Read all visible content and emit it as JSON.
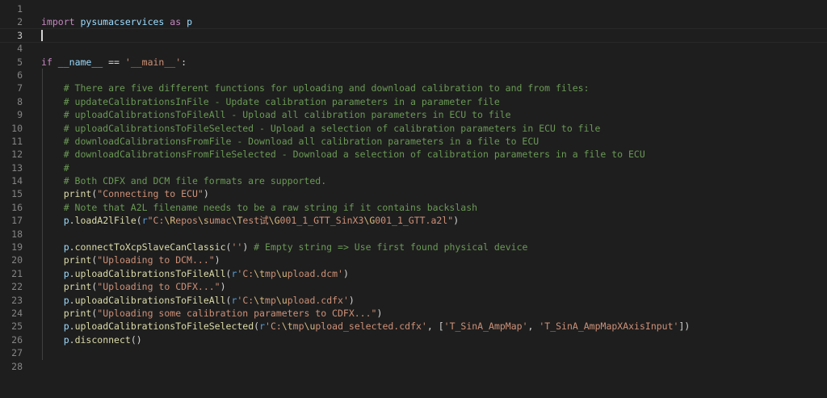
{
  "editor": {
    "lines": [
      {
        "n": "1",
        "tokens": []
      },
      {
        "n": "2",
        "tokens": [
          [
            "kw",
            "import"
          ],
          [
            "op",
            " "
          ],
          [
            "var",
            "pysumacservices"
          ],
          [
            "op",
            " "
          ],
          [
            "kw",
            "as"
          ],
          [
            "op",
            " "
          ],
          [
            "var",
            "p"
          ]
        ]
      },
      {
        "n": "3",
        "tokens": [],
        "current": true
      },
      {
        "n": "4",
        "tokens": []
      },
      {
        "n": "5",
        "tokens": [
          [
            "kw",
            "if"
          ],
          [
            "op",
            " "
          ],
          [
            "var",
            "__name__"
          ],
          [
            "op",
            " == "
          ],
          [
            "str",
            "'__main__'"
          ],
          [
            "op",
            ":"
          ]
        ]
      },
      {
        "n": "6",
        "tokens": []
      },
      {
        "n": "7",
        "tokens": [
          [
            "op",
            "    "
          ],
          [
            "cm",
            "# There are five different functions for uploading and download calibration to and from files:"
          ]
        ]
      },
      {
        "n": "8",
        "tokens": [
          [
            "op",
            "    "
          ],
          [
            "cm",
            "# updateCalibrationsInFile - Update calibration parameters in a parameter file"
          ]
        ]
      },
      {
        "n": "9",
        "tokens": [
          [
            "op",
            "    "
          ],
          [
            "cm",
            "# uploadCalibrationsToFileAll - Upload all calibration parameters in ECU to file"
          ]
        ]
      },
      {
        "n": "10",
        "tokens": [
          [
            "op",
            "    "
          ],
          [
            "cm",
            "# uploadCalibrationsToFileSelected - Upload a selection of calibration parameters in ECU to file"
          ]
        ]
      },
      {
        "n": "11",
        "tokens": [
          [
            "op",
            "    "
          ],
          [
            "cm",
            "# downloadCalibrationsFromFile - Download all calibration parameters in a file to ECU"
          ]
        ]
      },
      {
        "n": "12",
        "tokens": [
          [
            "op",
            "    "
          ],
          [
            "cm",
            "# downloadCalibrationsFromFileSelected - Download a selection of calibration parameters in a file to ECU"
          ]
        ]
      },
      {
        "n": "13",
        "tokens": [
          [
            "op",
            "    "
          ],
          [
            "cm",
            "#"
          ]
        ]
      },
      {
        "n": "14",
        "tokens": [
          [
            "op",
            "    "
          ],
          [
            "cm",
            "# Both CDFX and DCM file formats are supported."
          ]
        ]
      },
      {
        "n": "15",
        "tokens": [
          [
            "op",
            "    "
          ],
          [
            "fn",
            "print"
          ],
          [
            "op",
            "("
          ],
          [
            "str",
            "\"Connecting to ECU\""
          ],
          [
            "op",
            ")"
          ]
        ]
      },
      {
        "n": "16",
        "tokens": [
          [
            "op",
            "    "
          ],
          [
            "cm",
            "# Note that A2L filename needs to be a raw string if it contains backslash"
          ]
        ]
      },
      {
        "n": "17",
        "tokens": [
          [
            "op",
            "    "
          ],
          [
            "var",
            "p"
          ],
          [
            "op",
            "."
          ],
          [
            "fn",
            "loadA2lFile"
          ],
          [
            "op",
            "("
          ],
          [
            "kw2",
            "r"
          ],
          [
            "str",
            "\"C:"
          ],
          [
            "esc",
            "\\R"
          ],
          [
            "str",
            "epos"
          ],
          [
            "esc",
            "\\s"
          ],
          [
            "str",
            "umac"
          ],
          [
            "esc",
            "\\T"
          ],
          [
            "str",
            "est试"
          ],
          [
            "esc",
            "\\G"
          ],
          [
            "str",
            "001_1_GTT_SinX3"
          ],
          [
            "esc",
            "\\G"
          ],
          [
            "str",
            "001_1_GTT.a2l\""
          ],
          [
            "op",
            ")"
          ]
        ]
      },
      {
        "n": "18",
        "tokens": []
      },
      {
        "n": "19",
        "tokens": [
          [
            "op",
            "    "
          ],
          [
            "var",
            "p"
          ],
          [
            "op",
            "."
          ],
          [
            "fn",
            "connectToXcpSlaveCanClassic"
          ],
          [
            "op",
            "("
          ],
          [
            "str",
            "''"
          ],
          [
            "op",
            ") "
          ],
          [
            "cm",
            "# Empty string => Use first found physical device"
          ]
        ]
      },
      {
        "n": "20",
        "tokens": [
          [
            "op",
            "    "
          ],
          [
            "fn",
            "print"
          ],
          [
            "op",
            "("
          ],
          [
            "str",
            "\"Uploading to DCM...\""
          ],
          [
            "op",
            ")"
          ]
        ]
      },
      {
        "n": "21",
        "tokens": [
          [
            "op",
            "    "
          ],
          [
            "var",
            "p"
          ],
          [
            "op",
            "."
          ],
          [
            "fn",
            "uploadCalibrationsToFileAll"
          ],
          [
            "op",
            "("
          ],
          [
            "kw2",
            "r"
          ],
          [
            "str",
            "'C:"
          ],
          [
            "esc",
            "\\t"
          ],
          [
            "str",
            "mp"
          ],
          [
            "esc",
            "\\u"
          ],
          [
            "str",
            "pload.dcm'"
          ],
          [
            "op",
            ")"
          ]
        ]
      },
      {
        "n": "22",
        "tokens": [
          [
            "op",
            "    "
          ],
          [
            "fn",
            "print"
          ],
          [
            "op",
            "("
          ],
          [
            "str",
            "\"Uploading to CDFX...\""
          ],
          [
            "op",
            ")"
          ]
        ]
      },
      {
        "n": "23",
        "tokens": [
          [
            "op",
            "    "
          ],
          [
            "var",
            "p"
          ],
          [
            "op",
            "."
          ],
          [
            "fn",
            "uploadCalibrationsToFileAll"
          ],
          [
            "op",
            "("
          ],
          [
            "kw2",
            "r"
          ],
          [
            "str",
            "'C:"
          ],
          [
            "esc",
            "\\t"
          ],
          [
            "str",
            "mp"
          ],
          [
            "esc",
            "\\u"
          ],
          [
            "str",
            "pload.cdfx'"
          ],
          [
            "op",
            ")"
          ]
        ]
      },
      {
        "n": "24",
        "tokens": [
          [
            "op",
            "    "
          ],
          [
            "fn",
            "print"
          ],
          [
            "op",
            "("
          ],
          [
            "str",
            "\"Uploading some calibration parameters to CDFX...\""
          ],
          [
            "op",
            ")"
          ]
        ]
      },
      {
        "n": "25",
        "tokens": [
          [
            "op",
            "    "
          ],
          [
            "var",
            "p"
          ],
          [
            "op",
            "."
          ],
          [
            "fn",
            "uploadCalibrationsToFileSelected"
          ],
          [
            "op",
            "("
          ],
          [
            "kw2",
            "r"
          ],
          [
            "str",
            "'C:"
          ],
          [
            "esc",
            "\\t"
          ],
          [
            "str",
            "mp"
          ],
          [
            "esc",
            "\\u"
          ],
          [
            "str",
            "pload_selected.cdfx'"
          ],
          [
            "op",
            ", ["
          ],
          [
            "str",
            "'T_SinA_AmpMap'"
          ],
          [
            "op",
            ", "
          ],
          [
            "str",
            "'T_SinA_AmpMapXAxisInput'"
          ],
          [
            "op",
            "])"
          ]
        ]
      },
      {
        "n": "26",
        "tokens": [
          [
            "op",
            "    "
          ],
          [
            "var",
            "p"
          ],
          [
            "op",
            "."
          ],
          [
            "fn",
            "disconnect"
          ],
          [
            "op",
            "()"
          ]
        ]
      },
      {
        "n": "27",
        "tokens": []
      },
      {
        "n": "28",
        "tokens": []
      }
    ]
  },
  "colors": {
    "background": "#1e1e1e",
    "keyword": "#c586c0",
    "storage": "#569cd6",
    "function": "#dcdcaa",
    "variable": "#9cdcfe",
    "string": "#ce9178",
    "comment": "#6a9955",
    "escape": "#d7ba7d"
  }
}
